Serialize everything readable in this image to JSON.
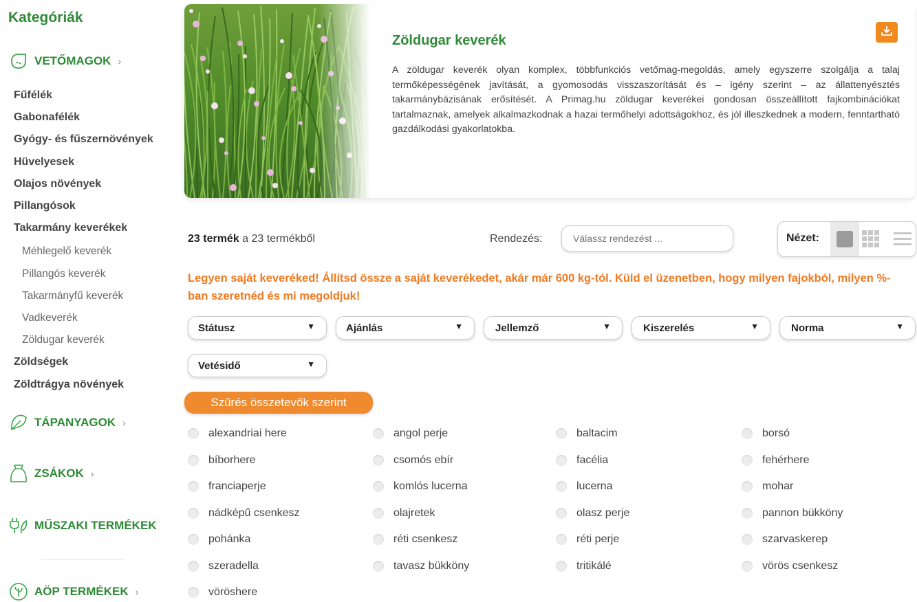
{
  "sidebar": {
    "title": "Kategóriák",
    "main": {
      "seeds": {
        "label": "VETŐMAGOK",
        "chev": "›"
      },
      "nutrients": {
        "label": "TÁPANYAGOK",
        "chev": "›"
      },
      "bags": {
        "label": "ZSÁKOK",
        "chev": "›"
      },
      "tech": {
        "label": "MŰSZAKI TERMÉKEK"
      },
      "aop": {
        "label": "AÖP TERMÉKEK",
        "chev": "›"
      }
    },
    "seed_items": [
      "Fűfélék",
      "Gabonafélék",
      "Gyógy- és fűszernövények",
      "Hüvelyesek",
      "Olajos növények",
      "Pillangósok",
      "Takarmány keverékek"
    ],
    "feed_mix_items": [
      "Méhlegelő keverék",
      "Pillangós keverék",
      "Takarmányfű keverék",
      "Vadkeverék",
      "Zöldugar keverék"
    ],
    "seed_items_after": [
      "Zöldségek",
      "Zöldtrágya növények"
    ]
  },
  "hero": {
    "title": "Zöldugar keverék",
    "description": "A zöldugar keverék olyan komplex, többfunkciós vetőmag-megoldás, amely egyszerre szolgálja a talaj termőképességének javítását, a gyomosodás visszaszorítását és – igény szerint – az állattenyésztés takarmánybázisának erősítését. A Primag.hu zöldugar keverékei gondosan összeállított fajkombinációkat tartalmaznak, amelyek alkalmazkodnak a hazai termőhelyi adottságokhoz, és jól illeszkednek a modern, fenntartható gazdálkodási gyakorlatokba."
  },
  "toolbar": {
    "count_bold": "23 termék",
    "count_rest": " a 23 termékből",
    "sort_label": "Rendezés:",
    "sort_placeholder": "Válassz rendezést ...",
    "view_label": "Nézet:"
  },
  "promo": "Legyen saját keveréked! Állítsd össze a saját keverékedet, akár már 600 kg-tól. Küld el üzenetben, hogy milyen fajokból, milyen %-ban szeretnéd és mi megoldjuk!",
  "filters": [
    {
      "label": "Státusz"
    },
    {
      "label": "Ajánlás"
    },
    {
      "label": "Jellemző"
    },
    {
      "label": "Kiszerelés"
    },
    {
      "label": "Norma"
    },
    {
      "label": "Vetésidő"
    }
  ],
  "filter_arrow": "▼",
  "ingredient_button": "Szűrés összetevők szerint",
  "ingredients": [
    "alexandriai here",
    "angol perje",
    "baltacim",
    "borsó",
    "bíborhere",
    "csomós ebír",
    "facélia",
    "fehérhere",
    "franciaperje",
    "komlós lucerna",
    "lucerna",
    "mohar",
    "nádképű csenkesz",
    "olajretek",
    "olasz perje",
    "pannon bükköny",
    "pohánka",
    "réti csenkesz",
    "réti perje",
    "szarvaskerep",
    "szeradella",
    "tavasz bükköny",
    "tritikálé",
    "vörös csenkesz",
    "vöröshere"
  ],
  "colors": {
    "green": "#2e8a36",
    "orange": "#f08a2e",
    "text": "#444444"
  }
}
